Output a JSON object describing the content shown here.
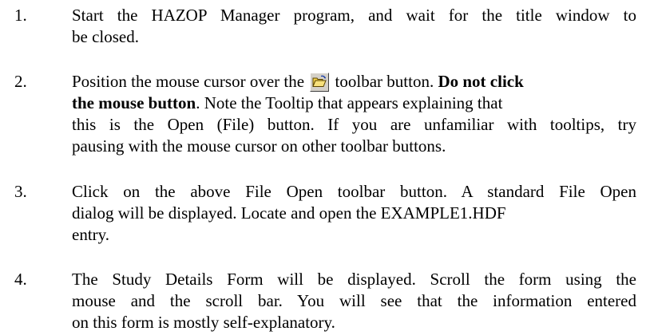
{
  "steps": [
    {
      "number": "1.",
      "lines": [
        "Start the HAZOP Manager program, and wait for the title window to",
        "be closed."
      ]
    },
    {
      "number": "2.",
      "line1_before_icon": "Position the mouse cursor over the",
      "line1_after_icon": "toolbar button.",
      "line1_bold": "Do not click",
      "line2_bold": "the mouse button",
      "line2_rest": ".  Note the Tooltip that appears explaining that",
      "line3": "this is the Open (File) button.  If you are unfamiliar with tooltips, try",
      "line4": "pausing with the mouse cursor on other toolbar buttons.",
      "icon": "open-folder-icon"
    },
    {
      "number": "3.",
      "lines": [
        "Click on the above File Open toolbar button.  A standard File Open",
        "dialog will be displayed.  Locate and open the EXAMPLE1.HDF",
        "entry."
      ]
    },
    {
      "number": "4.",
      "lines": [
        "The Study Details Form will be displayed.  Scroll the form using the",
        "mouse and the scroll bar.  You will see that the information entered",
        "on this form is mostly self-explanatory."
      ]
    }
  ]
}
